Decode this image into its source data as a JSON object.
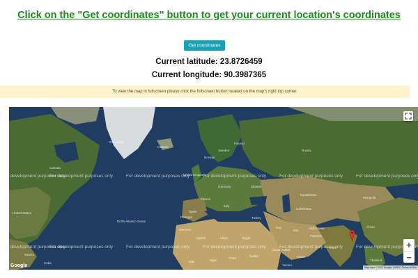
{
  "heading": "Click on the \"Get coordinates\" button to get your current location's coordinates",
  "button_label": "Get coordinates",
  "latitude_label": "Current latitude: 23.8726459",
  "longitude_label": "Current longitude: 90.3987365",
  "notice": "To view the map in fullscreen please click the fullscreen button located on the map's right top corner.",
  "map": {
    "watermark": "For development purposes only",
    "logo": "Google",
    "attribution": "Map data ©2021 Google, INEGI | Terms of Use",
    "zoom_in": "+",
    "zoom_out": "−",
    "marker_location": "Dhaka, Bangladesh",
    "labels": {
      "greenland": "Greenland",
      "iceland": "Iceland",
      "canada": "Canada",
      "united_states": "United States",
      "north_atlantic": "North Atlantic Ocean",
      "russia": "Russia",
      "kazakhstan": "Kazakhstan",
      "mongolia": "Mongolia",
      "china": "China",
      "india": "India",
      "iran": "Iran",
      "turkey": "Turkey",
      "egypt": "Egypt",
      "libya": "Libya",
      "algeria": "Algeria",
      "saudi_arabia": "Saudi Arabia",
      "afghanistan": "Afghanistan",
      "pakistan": "Pakistan",
      "mexico": "Mexico",
      "spain": "Spain",
      "france": "France",
      "germany": "Germany",
      "ukraine": "Ukraine",
      "sweden": "Sweden",
      "norway": "Norway",
      "finland": "Finland",
      "uk": "United Kingdom",
      "uzbekistan": "Uzbekistan",
      "thailand": "Thailand",
      "portugal": "Portugal",
      "italy": "Italy",
      "iraq": "Iraq",
      "oman": "Oman",
      "morocco": "Morocco",
      "mali": "Mali",
      "niger": "Niger",
      "chad": "Chad",
      "sudan": "Sudan",
      "yemen": "Yemen",
      "cuba": "Cuba"
    }
  }
}
